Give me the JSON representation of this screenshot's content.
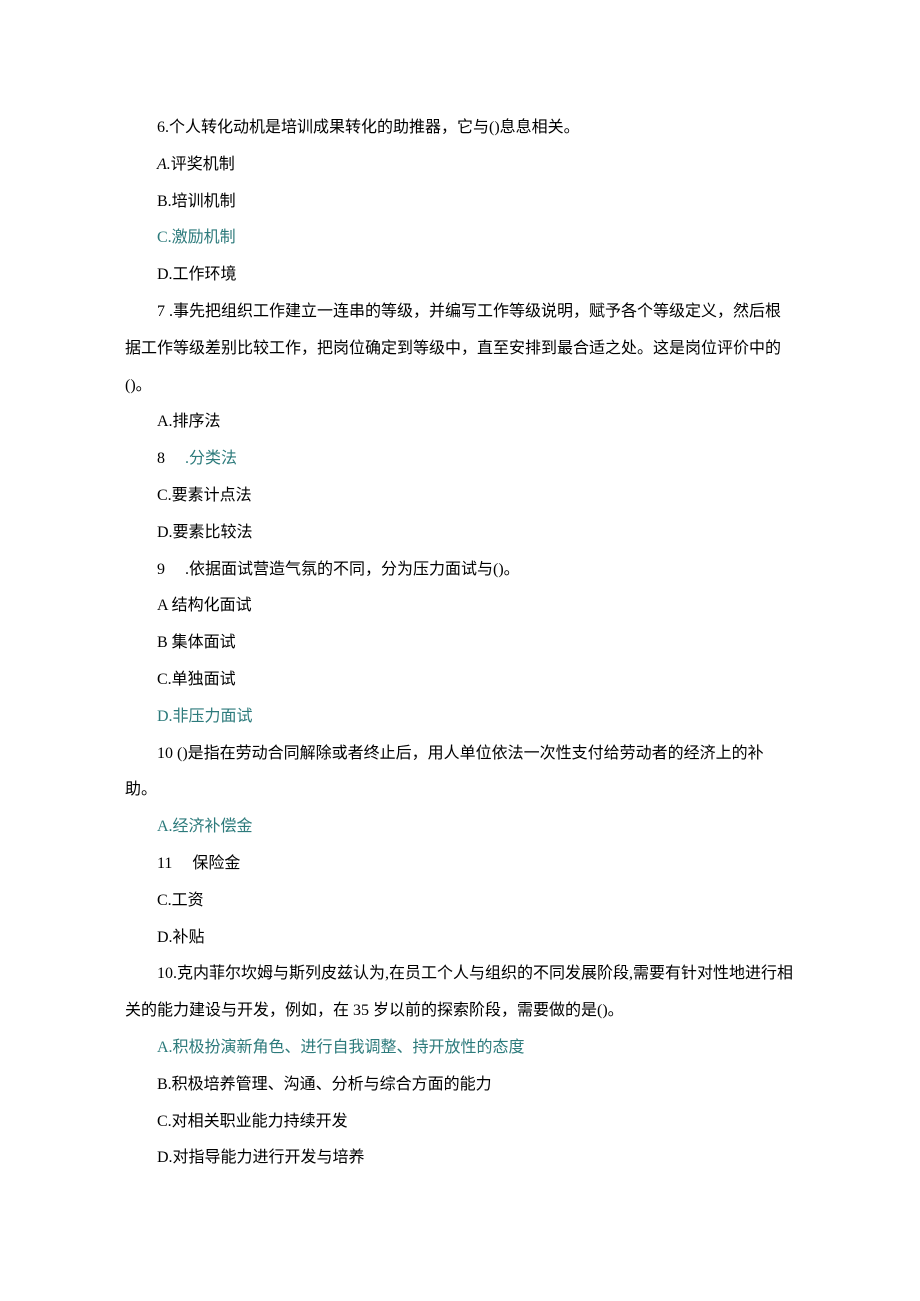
{
  "q6": {
    "text": "6.个人转化动机是培训成果转化的助推器，它与()息息相关。",
    "a": "评奖机制",
    "a_label": "A.",
    "b": "B.培训机制",
    "c": "C.激励机制",
    "d": "D.工作环境"
  },
  "q7": {
    "text": "7 .事先把组织工作建立一连串的等级，并编写工作等级说明，赋予各个等级定义，然后根据工作等级差别比较工作，把岗位确定到等级中，直至安排到最合适之处。这是岗位评价中的()。",
    "a": "A.排序法",
    "b_num": "8",
    "b_text": ".分类法",
    "c": "C.要素计点法",
    "d": "D.要素比较法"
  },
  "q8": {
    "num": "9",
    "text": ".依据面试营造气氛的不同，分为压力面试与()。",
    "a": "A 结构化面试",
    "b": "B 集体面试",
    "c": "C.单独面试",
    "d": "D.非压力面试"
  },
  "q9": {
    "text": "10 ()是指在劳动合同解除或者终止后，用人单位依法一次性支付给劳动者的经济上的补助。",
    "a": "A.经济补偿金",
    "b_num": "11",
    "b_text": "保险金",
    "c": "C.工资",
    "d": "D.补贴"
  },
  "q10": {
    "text": "10.克内菲尔坎姆与斯列皮兹认为,在员工个人与组织的不同发展阶段,需要有针对性地进行相关的能力建设与开发，例如，在 35 岁以前的探索阶段，需要做的是()。",
    "a": "A.积极扮演新角色、进行自我调整、持开放性的态度",
    "b": "B.积极培养管理、沟通、分析与综合方面的能力",
    "c": "C.对相关职业能力持续开发",
    "d": "D.对指导能力进行开发与培养"
  }
}
